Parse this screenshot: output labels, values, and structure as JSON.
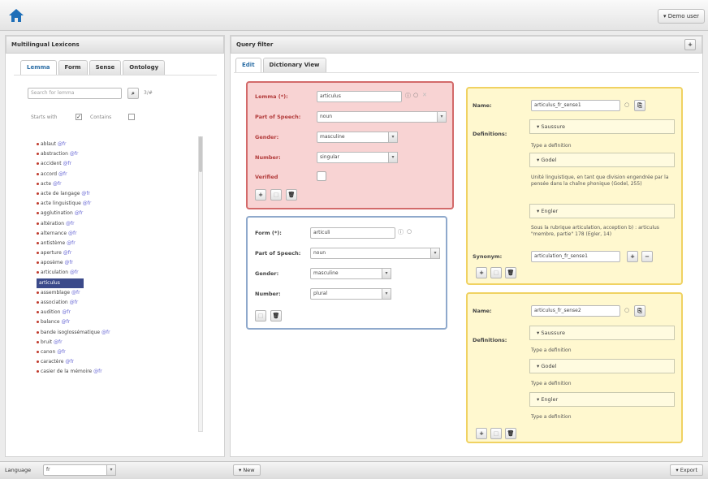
{
  "topbar": {
    "user_label": "▾ Demo user"
  },
  "left": {
    "title": "Multilingual Lexicons",
    "tabs": [
      "Lemma",
      "Form",
      "Sense",
      "Ontology"
    ],
    "search_placeholder": "Search for lemma",
    "search_count": "3/#",
    "starts_with": "Starts with",
    "contains": "Contains",
    "lemmas": [
      {
        "name": "ablaut",
        "lang": "@fr"
      },
      {
        "name": "abstraction",
        "lang": "@fr"
      },
      {
        "name": "accident",
        "lang": "@fr"
      },
      {
        "name": "accord",
        "lang": "@fr"
      },
      {
        "name": "acte",
        "lang": "@fr"
      },
      {
        "name": "acte de langage",
        "lang": "@fr"
      },
      {
        "name": "acte linguistique",
        "lang": "@fr"
      },
      {
        "name": "agglutination",
        "lang": "@fr"
      },
      {
        "name": "altération",
        "lang": "@fr"
      },
      {
        "name": "alternance",
        "lang": "@fr"
      },
      {
        "name": "antistème",
        "lang": "@fr"
      },
      {
        "name": "aperture",
        "lang": "@fr"
      },
      {
        "name": "aposème",
        "lang": "@fr"
      },
      {
        "name": "articulation",
        "lang": "@fr"
      },
      {
        "name": "articulus",
        "lang": "",
        "selected": true
      },
      {
        "name": "assemblage",
        "lang": "@fr"
      },
      {
        "name": "association",
        "lang": "@fr"
      },
      {
        "name": "audition",
        "lang": "@fr"
      },
      {
        "name": "balance",
        "lang": "@fr"
      },
      {
        "name": "bande isoglossématique",
        "lang": "@fr"
      },
      {
        "name": "bruit",
        "lang": "@fr"
      },
      {
        "name": "canon",
        "lang": "@fr"
      },
      {
        "name": "caractère",
        "lang": "@fr"
      },
      {
        "name": "casier de la mémoire",
        "lang": "@fr"
      }
    ]
  },
  "right": {
    "title": "Query filter",
    "tabs": [
      "Edit",
      "Dictionary View"
    ],
    "lemma_card": {
      "lemma_label": "Lemma (*):",
      "lemma_value": "articulus",
      "pos_label": "Part of Speech:",
      "pos_value": "noun",
      "gender_label": "Gender:",
      "gender_value": "masculine",
      "number_label": "Number:",
      "number_value": "singular",
      "verified_label": "Verified"
    },
    "form_card": {
      "form_label": "Form (*):",
      "form_value": "articuli",
      "pos_label": "Part of Speech:",
      "pos_value": "noun",
      "gender_label": "Gender:",
      "gender_value": "masculine",
      "number_label": "Number:",
      "number_value": "plural"
    },
    "sense1": {
      "name_label": "Name:",
      "name_value": "articulus_fr_sense1",
      "definitions_label": "Definitions:",
      "defs": [
        {
          "author": "▾ Saussure",
          "text": "Type a definition"
        },
        {
          "author": "▾ Godel",
          "text": "Unité linguistique, en tant que division engendrée par la pensée dans la chaîne phonique (Godel, 255)"
        },
        {
          "author": "▾ Engler",
          "text": "Sous la rubrique articulation, acception b) : articulus \"membre, partie\" 178 (Egler, 14)"
        }
      ],
      "synonym_label": "Synonym:",
      "synonym_value": "articulation_fr_sense1"
    },
    "sense2": {
      "name_label": "Name:",
      "name_value": "articulus_fr_sense2",
      "definitions_label": "Definitions:",
      "defs": [
        {
          "author": "▾ Saussure",
          "text": "Type a definition"
        },
        {
          "author": "▾ Godel",
          "text": "Type a definition"
        },
        {
          "author": "▾ Engler",
          "text": "Type a definition"
        }
      ]
    }
  },
  "bottom": {
    "language_label": "Language",
    "language_value": "fr",
    "new_label": "▾ New",
    "export_label": "▾ Export"
  }
}
